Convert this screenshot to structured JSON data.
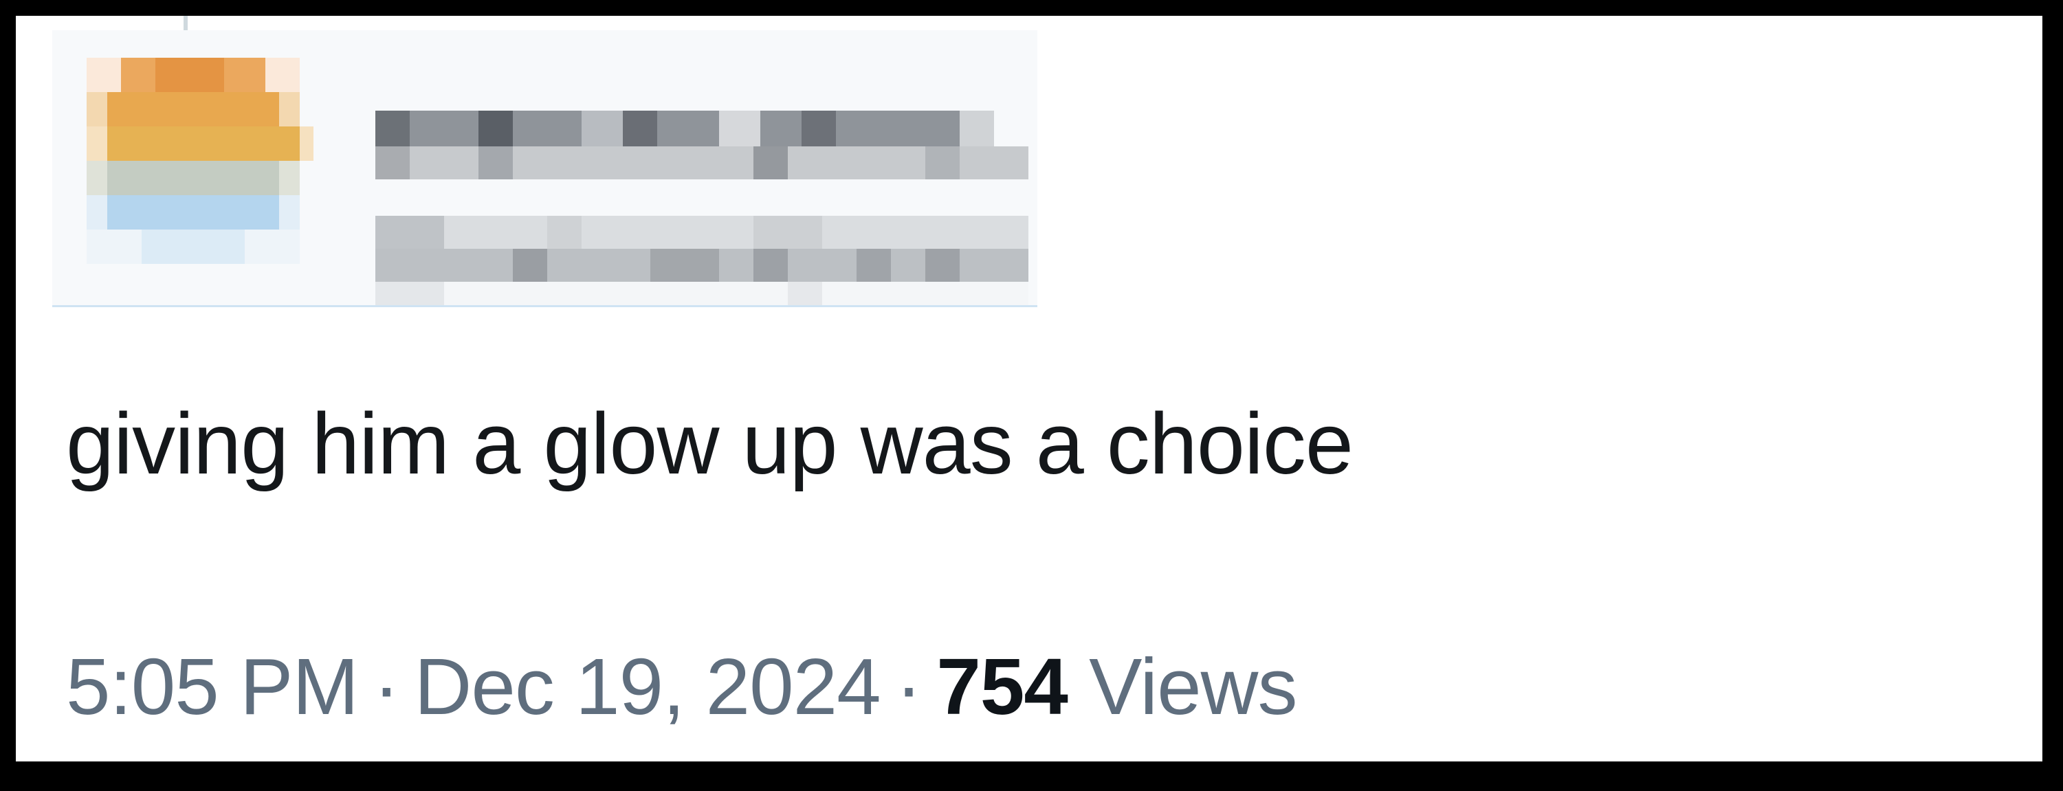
{
  "tweet": {
    "text": "giving him a glow up was a choice",
    "time": "5:05 PM",
    "separator": "·",
    "date": "Dec 19, 2024",
    "views_count": "754",
    "views_label": "Views"
  },
  "redacted_header": {
    "avatar_colors": [
      "#e7a24f",
      "#f0c173",
      "#b7d6ee"
    ],
    "text_bar_color": "#8f949a"
  }
}
